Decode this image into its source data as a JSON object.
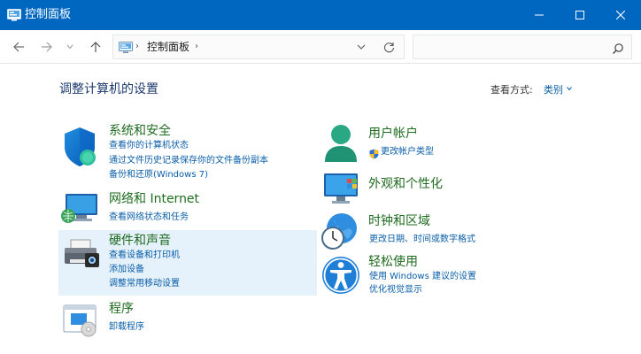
{
  "window": {
    "title": "控制面板"
  },
  "nav": {
    "back_icon": "arrow-left-icon",
    "forward_icon": "arrow-right-icon",
    "recent_icon": "chevron-down-icon",
    "up_icon": "arrow-up-icon",
    "address_text": "控制面板",
    "search_placeholder": ""
  },
  "content": {
    "heading": "调整计算机的设置",
    "view_by_label": "查看方式:",
    "view_by_value": "类别"
  },
  "categories": {
    "system_security": {
      "title": "系统和安全",
      "links": [
        "查看你的计算机状态",
        "通过文件历史记录保存你的文件备份副本",
        "备份和还原(Windows 7)"
      ]
    },
    "network": {
      "title": "网络和 Internet",
      "links": [
        "查看网络状态和任务"
      ]
    },
    "hardware": {
      "title": "硬件和声音",
      "links": [
        "查看设备和打印机",
        "添加设备",
        "调整常用移动设置"
      ]
    },
    "programs": {
      "title": "程序",
      "links": [
        "卸载程序"
      ]
    },
    "user_accounts": {
      "title": "用户帐户",
      "links": [
        "更改帐户类型"
      ]
    },
    "appearance": {
      "title": "外观和个性化",
      "links": []
    },
    "clock_region": {
      "title": "时钟和区域",
      "links": [
        "更改日期、时间或数字格式"
      ]
    },
    "ease_of_access": {
      "title": "轻松使用",
      "links": [
        "使用 Windows 建议的设置",
        "优化视觉显示"
      ]
    }
  },
  "colors": {
    "titlebar": "#0067c0",
    "category_title": "#1f6b1f",
    "link": "#0a5ea8",
    "heading": "#1e3a6e",
    "hover_highlight": "#e5f1fb"
  }
}
